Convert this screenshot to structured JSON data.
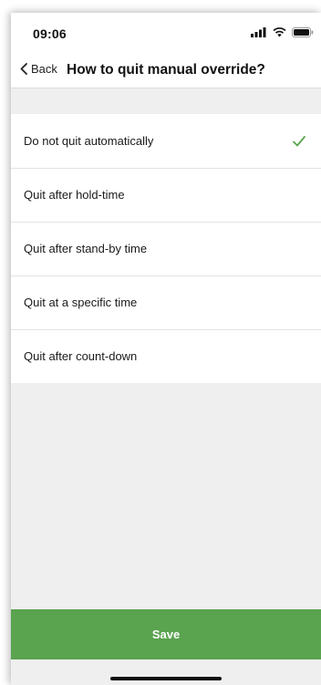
{
  "status_bar": {
    "time": "09:06",
    "icons": [
      "cellular-signal-icon",
      "wifi-icon",
      "battery-icon"
    ]
  },
  "nav": {
    "back_label": "Back",
    "back_icon": "chevron-left-icon",
    "title": "How to quit manual override?"
  },
  "options": [
    {
      "label": "Do not quit automatically",
      "selected": true
    },
    {
      "label": "Quit after hold-time",
      "selected": false
    },
    {
      "label": "Quit after stand-by time",
      "selected": false
    },
    {
      "label": "Quit at a specific time",
      "selected": false
    },
    {
      "label": "Quit after count-down",
      "selected": false
    }
  ],
  "save_label": "Save",
  "colors": {
    "accent_green": "#5aa34f",
    "check_green": "#5aa34f",
    "background": "#efefef"
  }
}
